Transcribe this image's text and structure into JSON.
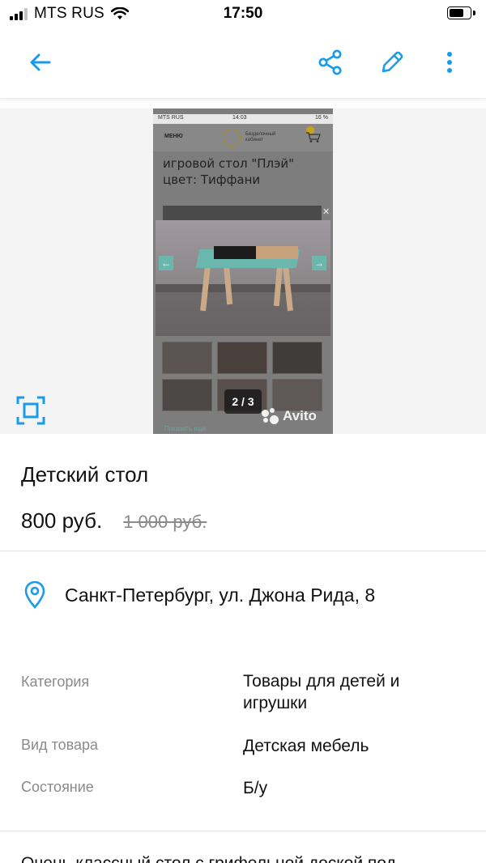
{
  "status_bar": {
    "carrier": "MTS RUS",
    "time": "17:50",
    "battery_level": 0.7
  },
  "toolbar": {
    "icons": [
      "arrow-left-icon",
      "share-icon",
      "pencil-icon",
      "more-vertical-icon"
    ],
    "accent_color": "#1a9bea"
  },
  "gallery": {
    "counter": "2 / 3",
    "watermark": "Avito",
    "screenshot": {
      "carrier": "MTS RUS",
      "time": "14:03",
      "battery": "16 %",
      "menu_label": "МЕНЮ",
      "logo_text": "Безделочный кабинет",
      "title": "игровой стол \"Плэй\" цвет: Тиффани",
      "show_more": "Показать еще"
    }
  },
  "listing": {
    "title": "Детский стол",
    "price": "800 руб.",
    "old_price": "1 000 руб.",
    "address": "Санкт-Петербург, ул. Джона Рида, 8"
  },
  "params": [
    {
      "label": "Категория",
      "value": "Товары для детей и игрушки"
    },
    {
      "label": "Вид товара",
      "value": "Детская мебель"
    },
    {
      "label": "Состояние",
      "value": "Б/у"
    }
  ],
  "description": "Очень классный стол с грифельной доской под"
}
